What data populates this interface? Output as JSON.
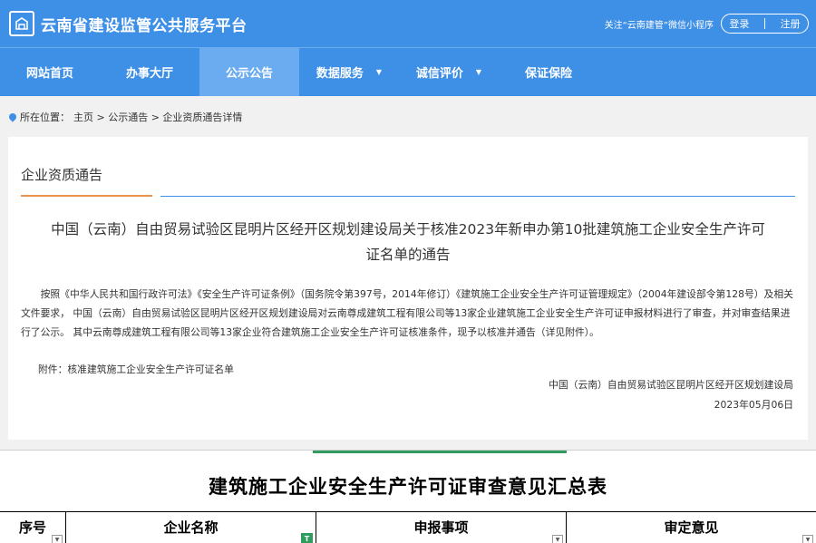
{
  "header": {
    "site_title": "云南省建设监管公共服务平台",
    "wechat_note": "关注“云南建管”微信小程序",
    "login_label": "登录",
    "register_label": "注册"
  },
  "nav": {
    "items": [
      {
        "label": "网站首页",
        "active": false,
        "dropdown": false
      },
      {
        "label": "办事大厅",
        "active": false,
        "dropdown": false
      },
      {
        "label": "公示公告",
        "active": true,
        "dropdown": false
      },
      {
        "label": "数据服务",
        "active": false,
        "dropdown": true
      },
      {
        "label": "诚信评价",
        "active": false,
        "dropdown": true
      },
      {
        "label": "保证保险",
        "active": false,
        "dropdown": false
      }
    ],
    "caret": "▼"
  },
  "breadcrumb": {
    "prefix": "所在位置：",
    "path": "主页 > 公示通告 > 企业资质通告详情"
  },
  "notice": {
    "section_title": "企业资质通告",
    "title": "中国（云南）自由贸易试验区昆明片区经开区规划建设局关于核准2023年新申办第10批建筑施工企业安全生产许可证名单的通告",
    "body": "按照《中华人民共和国行政许可法》《安全生产许可证条例》（国务院令第397号，2014年修订）《建筑施工企业安全生产许可证管理规定》（2004年建设部令第128号）及相关文件要求， 中国（云南）自由贸易试验区昆明片区经开区规划建设局对云南尊成建筑工程有限公司等13家企业建筑施工企业安全生产许可证申报材料进行了审查，并对审查结果进行了公示。 其中云南尊成建筑工程有限公司等13家企业符合建筑施工企业安全生产许可证核准条件，现予以核准并通告（详见附件）。",
    "attachment": "附件：核准建筑施工企业安全生产许可证名单",
    "signature_org": "中国（云南）自由贸易试验区昆明片区经开区规划建设局",
    "signature_date": "2023年05月06日"
  },
  "sheet": {
    "title": "建筑施工企业安全生产许可证审查意见汇总表",
    "columns": [
      "序号",
      "企业名称",
      "申报事项",
      "审定意见"
    ],
    "filter_glyph": "▼",
    "filter_active_glyph": "T"
  },
  "colors": {
    "brand_blue": "#3e8fe6",
    "nav_active": "#6aacef",
    "title_accent": "#e9914b",
    "sheet_accent": "#2e9d5d"
  }
}
